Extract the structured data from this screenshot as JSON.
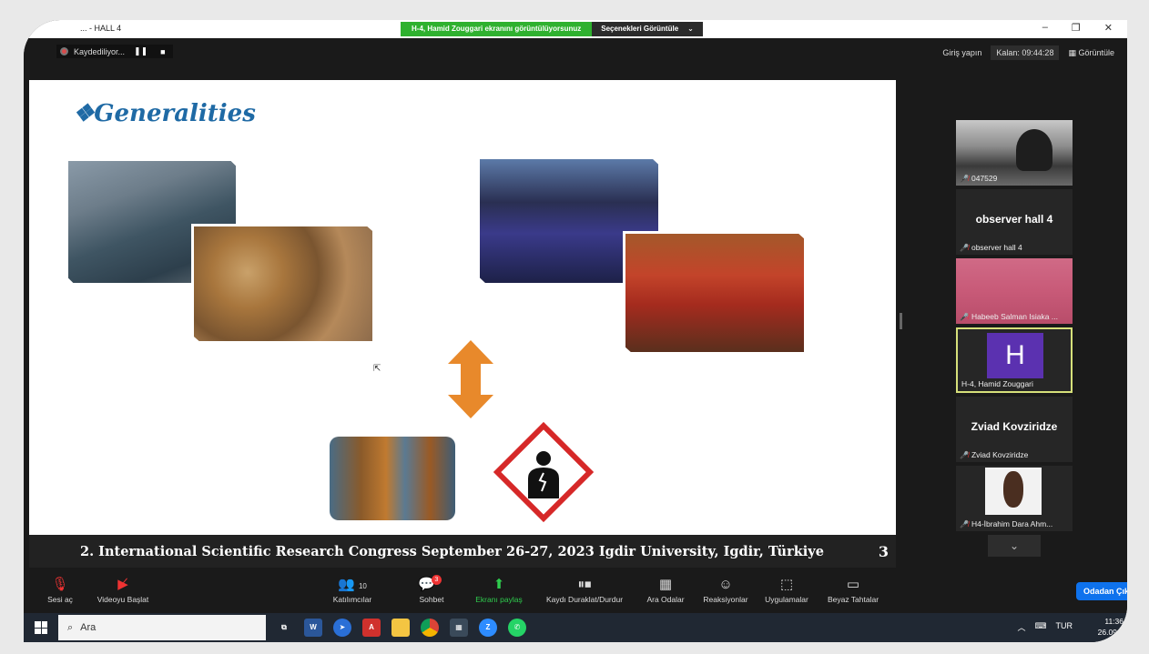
{
  "window": {
    "title": "... - HALL 4",
    "controls": [
      "–",
      "❐",
      "✕"
    ]
  },
  "share_banner": {
    "message": "H-4, Hamid Zouggari ekranını görüntülüyorsunuz",
    "options": "Seçenekleri Görüntüle",
    "chevron": "⌄"
  },
  "recording": {
    "label": "Kaydediliyor...",
    "pause": "❚❚",
    "stop": "■"
  },
  "top_right": {
    "signin": "Giriş yapın",
    "timer": "Kalan: 09:44:28",
    "view": "Görüntüle"
  },
  "slide": {
    "title": "❖Generalities",
    "footer": "2. International Scientific Research Congress September 26-27, 2023 Igdir University, Igdir, Türkiye",
    "page": "3"
  },
  "participants": [
    {
      "name": "047529",
      "type": "video",
      "muted": true
    },
    {
      "name": "observer hall 4",
      "display": "observer hall 4",
      "type": "name",
      "muted": true
    },
    {
      "name": "Habeeb Salman Isiaka ...",
      "type": "video",
      "muted": true
    },
    {
      "name": "H-4, Hamid Zouggari",
      "initial": "H",
      "type": "avatar",
      "active": true
    },
    {
      "name": "Zviad Kovziridze",
      "display": "Zviad Kovziridze",
      "type": "name",
      "muted": true
    },
    {
      "name": "H4-İbrahim Dara Ahm...",
      "type": "video",
      "muted": true
    }
  ],
  "more_participants": "⌄",
  "toolbar": {
    "audio": "Sesi aç",
    "video": "Videoyu Başlat",
    "participants": "Katılımcılar",
    "participants_count": "10",
    "chat": "Sohbet",
    "chat_badge": "3",
    "share": "Ekranı paylaş",
    "pause_record": "Kaydı Duraklat/Durdur",
    "breakout": "Ara Odalar",
    "reactions": "Reaksiyonlar",
    "apps": "Uygulamalar",
    "whiteboard": "Beyaz Tahtalar",
    "leave": "Odadan Çık"
  },
  "taskbar": {
    "search_placeholder": "Ara",
    "lang": "TUR",
    "time": "11:36",
    "date": "26.09..."
  },
  "colors": {
    "title_blue": "#1f6aa5",
    "share_green": "#2fb12f",
    "leave_blue": "#0e72ed",
    "active_tile": "#d6e07a",
    "avatar_purple": "#5b31b0"
  }
}
